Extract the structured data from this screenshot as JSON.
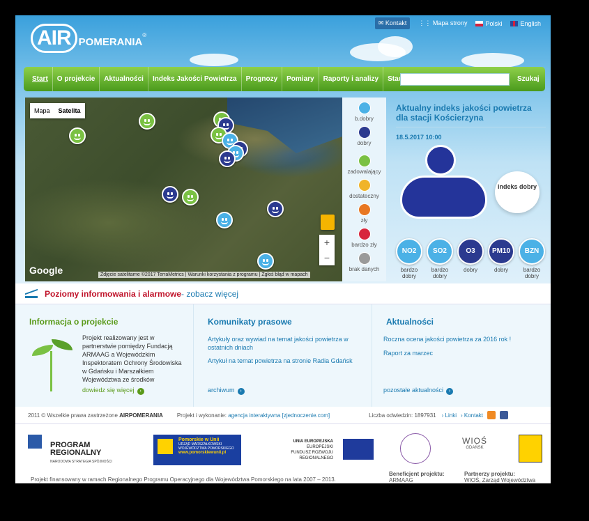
{
  "header": {
    "logo_air": "AIR",
    "logo_pomerania": "POMERANIA",
    "logo_reg": "®",
    "top_links": {
      "kontakt": "Kontakt",
      "mapa": "Mapa strony",
      "polski": "Polski",
      "english": "English"
    }
  },
  "nav": {
    "items": [
      "Start",
      "O projekcie",
      "Aktualności",
      "Indeks Jakości Powietrza",
      "Prognozy",
      "Pomiary",
      "Raporty i analizy",
      "Stacje"
    ],
    "search_placeholder": "",
    "search_button": "Szukaj"
  },
  "map": {
    "type_map": "Mapa",
    "type_satellite": "Satelita",
    "google": "Google",
    "attribution": [
      "Zdjęcie satelitarne ©2017 TerraMetrics",
      "Warunki korzystania z programu",
      "Zgłoś błąd w mapach"
    ],
    "zoom_in": "+",
    "zoom_out": "−",
    "colors": {
      "green": "#7ac143",
      "navy": "#2b3a8f",
      "light_blue": "#4bb1e6"
    }
  },
  "legend": [
    {
      "label": "b.dobry",
      "color": "#4bb1e6"
    },
    {
      "label": "dobry",
      "color": "#2b3a8f"
    },
    {
      "label": "zadowalający",
      "color": "#7ac143"
    },
    {
      "label": "dostateczny",
      "color": "#f0b429"
    },
    {
      "label": "zły",
      "color": "#e87722"
    },
    {
      "label": "bardzo zły",
      "color": "#d7263d"
    },
    {
      "label": "brak danych",
      "color": "#9a9a9a"
    }
  ],
  "index": {
    "title": "Aktualny indeks jakości powietrza dla stacji Kościerzyna",
    "date": "18.5.2017 10:00",
    "bubble": "indeks dobry",
    "pollutants": [
      {
        "name": "NO2",
        "label": "bardzo dobry",
        "color": "#4bb1e6"
      },
      {
        "name": "SO2",
        "label": "bardzo dobry",
        "color": "#4bb1e6"
      },
      {
        "name": "O3",
        "label": "dobry",
        "color": "#2b3a8f"
      },
      {
        "name": "PM10",
        "label": "dobry",
        "color": "#2b3a8f"
      },
      {
        "name": "BZN",
        "label": "bardzo dobry",
        "color": "#4bb1e6"
      }
    ]
  },
  "alarm": {
    "title": "Poziomy informowania i alarmowe",
    "link": " - zobacz więcej"
  },
  "columns": {
    "info": {
      "title": "Informacja o projekcie",
      "text": "Projekt realizowany jest w partnerstwie pomiędzy Fundacją ARMAAG a Wojewódzkim Inspektoratem Ochrony Środowiska w Gdańsku i Marszałkiem Województwa ze środków",
      "more": "dowiedz się więcej"
    },
    "press": {
      "title": "Komunikaty prasowe",
      "link1": "Artykuły oraz wywiad na temat jakości powietrza w ostatnich dniach",
      "link2": "Artykuł na temat powietrza na stronie Radia Gdańsk",
      "more": "archiwum"
    },
    "news": {
      "title": "Aktualności",
      "link1": "Roczna ocena jakości powietrza za 2016 rok !",
      "link2": "Raport za marzec",
      "more": "pozostałe aktualności"
    }
  },
  "footer": {
    "copyright": "2011 © Wszelkie prawa zastrzeżone",
    "brand": "AIRPOMERANIA",
    "made_by": "Projekt i wykonanie:",
    "agency": "agencja interaktywna [zjednoczenie.com]",
    "visits_label": "Liczba odwiedzin:",
    "visits": "1897931",
    "links": "› Linki",
    "kontakt": "› Kontakt"
  },
  "logos": {
    "program_1": "PROGRAM",
    "program_2": "REGIONALNY",
    "program_sub": "NARODOWA STRATEGIA SPÓJNOŚCI",
    "pomorskie_1": "Pomorskie w Unii",
    "pomorskie_2": "URZĄD MARSZAŁKOWSKI WOJEWÓDZTWA POMORSKIEGO",
    "pomorskie_3": "www.pomorskiewunii.pl",
    "eu_1": "UNIA EUROPEJSKA",
    "eu_2": "EUROPEJSKI FUNDUSZ ROZWOJU REGIONALNEGO",
    "wios": "WIOŚ",
    "wios_sub": "GDAŃSK",
    "financed": "Projekt finansowany w ramach Regionalnego Programu Operacyjnego dla Województwa Pomorskiego na lata 2007 – 2013.",
    "beneficiary_label": "Beneficjent projektu:",
    "beneficiary": "ARMAAG",
    "partners_label": "Partnerzy projektu:",
    "partners": "WIOŚ, Zarząd Województwa"
  }
}
